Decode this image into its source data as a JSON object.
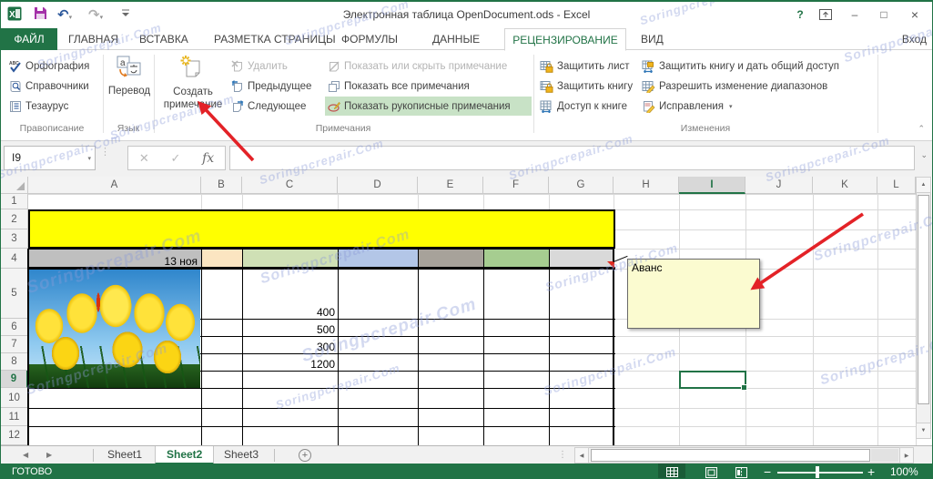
{
  "window": {
    "title": "Электронная таблица OpenDocument.ods - Excel",
    "sign_in": "Вход",
    "help": "?",
    "minimize": "–",
    "maximize": "□",
    "close": "×"
  },
  "tabs": {
    "items": [
      {
        "label": "ФАЙЛ"
      },
      {
        "label": "ГЛАВНАЯ"
      },
      {
        "label": "ВСТАВКА"
      },
      {
        "label": "РАЗМЕТКА СТРАНИЦЫ"
      },
      {
        "label": "ФОРМУЛЫ"
      },
      {
        "label": "ДАННЫЕ"
      },
      {
        "label": "РЕЦЕНЗИРОВАНИЕ"
      },
      {
        "label": "ВИД"
      }
    ],
    "active": "РЕЦЕНЗИРОВАНИЕ"
  },
  "ribbon": {
    "groups": [
      {
        "label": "Правописание",
        "items": [
          {
            "label": "Орфография",
            "icon": "spellcheck-icon"
          },
          {
            "label": "Справочники",
            "icon": "research-icon"
          },
          {
            "label": "Тезаурус",
            "icon": "thesaurus-icon"
          }
        ]
      },
      {
        "label": "Язык",
        "items": [
          {
            "label": "Перевод",
            "icon": "translate-icon"
          }
        ]
      },
      {
        "label": "Примечания",
        "big_button": {
          "label_line1": "Создать",
          "label_line2": "примечание",
          "icon": "new-comment-icon"
        },
        "nav_items": [
          {
            "label": "Удалить",
            "icon": "delete-comment-icon",
            "disabled": true
          },
          {
            "label": "Предыдущее",
            "icon": "previous-comment-icon"
          },
          {
            "label": "Следующее",
            "icon": "next-comment-icon"
          }
        ],
        "show_items": [
          {
            "label": "Показать или скрыть примечание",
            "icon": "show-hide-comment-icon",
            "disabled": true
          },
          {
            "label": "Показать все примечания",
            "icon": "show-all-comments-icon"
          },
          {
            "label": "Показать рукописные примечания",
            "icon": "ink-comments-icon",
            "selected": true
          }
        ]
      },
      {
        "label": "Изменения",
        "protect_items": [
          {
            "label": "Защитить лист",
            "icon": "protect-sheet-icon"
          },
          {
            "label": "Защитить книгу",
            "icon": "protect-workbook-icon"
          },
          {
            "label": "Доступ к книге",
            "icon": "share-workbook-icon"
          }
        ],
        "share_items": [
          {
            "label": "Защитить книгу и дать общий доступ",
            "icon": "protect-share-icon"
          },
          {
            "label": "Разрешить изменение диапазонов",
            "icon": "allow-edit-ranges-icon"
          },
          {
            "label": "Исправления",
            "icon": "track-changes-icon",
            "dropdown": true
          }
        ]
      }
    ]
  },
  "formula_bar": {
    "name_box_value": "I9",
    "fx_label": "fx",
    "cancel_glyph": "✕",
    "enter_glyph": "✓",
    "formula_value": ""
  },
  "grid": {
    "col_labels": [
      "A",
      "B",
      "C",
      "D",
      "E",
      "F",
      "G",
      "H",
      "I",
      "J",
      "K",
      "L"
    ],
    "row_labels": [
      "1",
      "2",
      "3",
      "4",
      "5",
      "6",
      "7",
      "8",
      "9",
      "10",
      "11",
      "12"
    ],
    "selected": {
      "col": "I",
      "row": "9",
      "cell": "I9"
    },
    "yellow_band": {
      "range": "A2:G3",
      "color": "#ffff00"
    },
    "cells": [
      {
        "ref": "A4",
        "value": "13 ноя",
        "bg": "#bfbfbf",
        "align": "right"
      },
      {
        "ref": "B4",
        "value": "",
        "bg": "#fbe5c1"
      },
      {
        "ref": "C4",
        "value": "",
        "bg": "#cfe0b5"
      },
      {
        "ref": "D4",
        "value": "",
        "bg": "#b3c6e7"
      },
      {
        "ref": "E4",
        "value": "",
        "bg": "#a7a29a"
      },
      {
        "ref": "F4",
        "value": "",
        "bg": "#a6cd90"
      },
      {
        "ref": "G4",
        "value": "",
        "bg": "#d9d9d9"
      },
      {
        "ref": "C5",
        "value": "400",
        "align": "right"
      },
      {
        "ref": "C6",
        "value": "500",
        "align": "right"
      },
      {
        "ref": "C7",
        "value": "300",
        "align": "right"
      },
      {
        "ref": "C8",
        "value": "1200",
        "align": "right"
      }
    ],
    "comment": {
      "cell": "G4",
      "text": "Аванс"
    }
  },
  "sheet_tabs": {
    "items": [
      {
        "label": "Sheet1"
      },
      {
        "label": "Sheet2",
        "active": true
      },
      {
        "label": "Sheet3"
      }
    ],
    "new_sheet_glyph": "+"
  },
  "status_bar": {
    "mode": "ГОТОВО",
    "zoom_level": "100%",
    "zoom_out_glyph": "−",
    "zoom_in_glyph": "+"
  },
  "watermark": {
    "text": "Soringpcrepair.Com"
  },
  "colors": {
    "accent_green": "#217346",
    "yellow_band": "#ffff00",
    "comment_bg": "#fbfbd0",
    "arrow_red": "#e32227",
    "selected_ribbon_item": "#c8e2c6"
  }
}
